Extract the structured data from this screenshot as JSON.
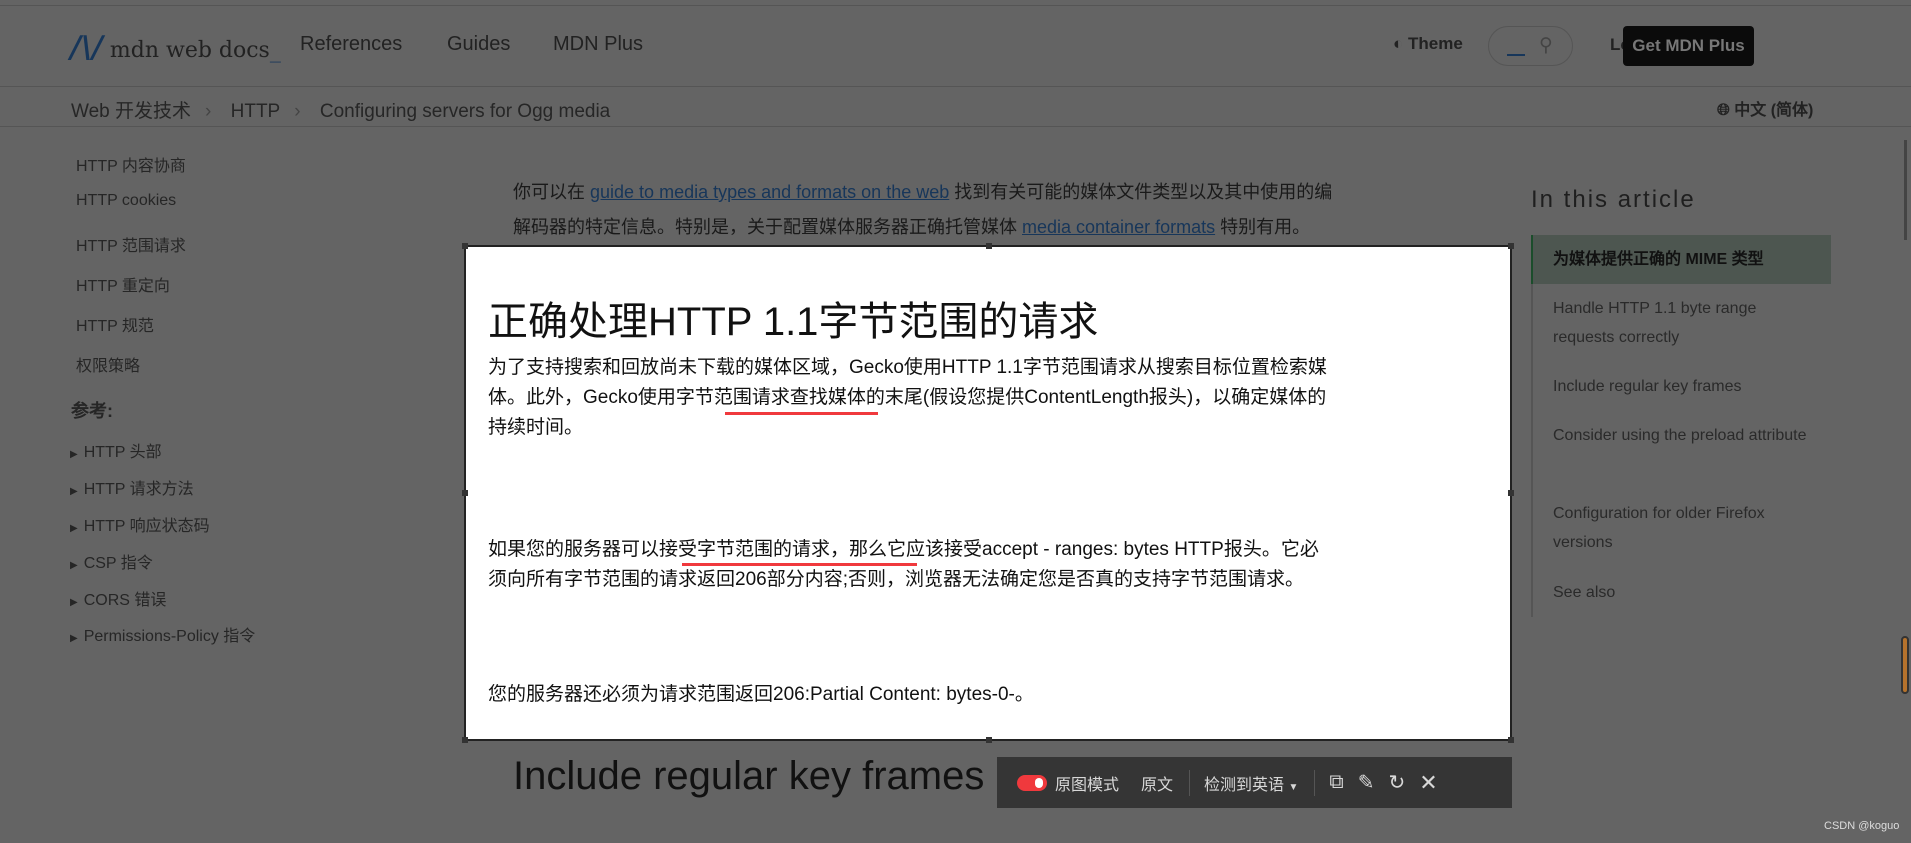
{
  "header": {
    "logo": "mdn web docs",
    "nav": [
      "References",
      "Guides",
      "MDN Plus"
    ],
    "theme": "Theme",
    "login": "Log in",
    "cta": "Get MDN Plus"
  },
  "breadcrumb": [
    "Web 开发技术",
    "HTTP",
    "Configuring servers for Ogg media"
  ],
  "language": "中文 (简体)",
  "sidebar": {
    "items": [
      "HTTP 内容协商",
      "HTTP cookies",
      "HTTP 范围请求",
      "HTTP 重定向",
      "HTTP 规范",
      "权限策略"
    ],
    "section": "参考:",
    "groups": [
      "HTTP 头部",
      "HTTP 请求方法",
      "HTTP 响应状态码",
      "CSP 指令",
      "CORS 错误",
      "Permissions-Policy 指令"
    ]
  },
  "main": {
    "intro_pre": "你可以在 ",
    "intro_link1": "guide to media types and formats on the web",
    "intro_mid": " 找到有关可能的媒体文件类型以及其中使用的编",
    "intro_line2_pre": "解码器的特定信息。特别是，关于配置媒体服务器正确托管媒体 ",
    "intro_link2": "media container formats",
    "intro_post": " 特别有用。",
    "next_heading": "Include regular key frames"
  },
  "overlay": {
    "title": "正确处理HTTP 1.1字节范围的请求",
    "p1_lines": [
      "为了支持搜索和回放尚未下载的媒体区域，Gecko使用HTTP 1.1字节范围请求从搜索目标位置检索媒",
      "体。此外，Gecko使用字节范围请求查找媒体的末尾(假设您提供ContentLength报头)，以确定媒体的",
      "持续时间。"
    ],
    "p2_lines": [
      "如果您的服务器可以接受字节范围的请求，那么它应该接受accept - ranges: bytes HTTP报头。它必",
      "须向所有字节范围的请求返回206部分内容;否则，浏览器无法确定您是否真的支持字节范围请求。"
    ],
    "p3": "您的服务器还必须为请求范围返回206:Partial Content: bytes-0-。"
  },
  "toolbar": {
    "toggle_label": "原图模式",
    "toggle_on": true,
    "original": "原文",
    "detect": "检测到英语",
    "accent": "#f0393d"
  },
  "toc": {
    "title": "In this article",
    "items": [
      "为媒体提供正确的 MIME 类型",
      "Handle HTTP 1.1 byte range requests correctly",
      "Include regular key frames",
      "Consider using the preload attribute",
      "Configuration for older Firefox versions",
      "See also"
    ]
  },
  "watermark": "CSDN @koguo"
}
